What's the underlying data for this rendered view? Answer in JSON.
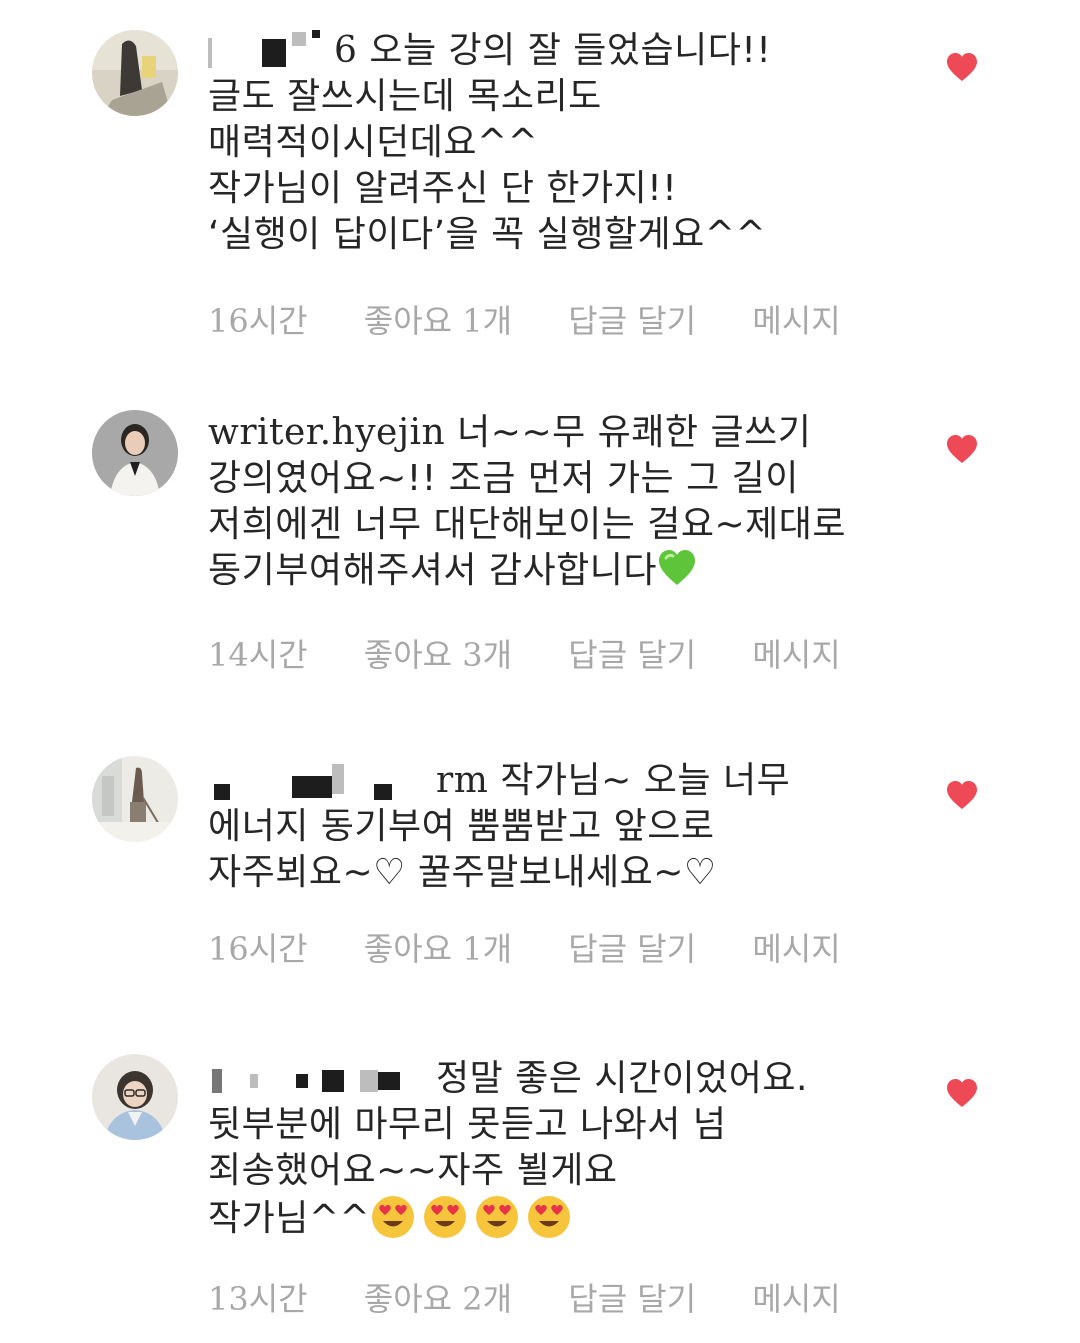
{
  "colors": {
    "like_heart": "#ed4956",
    "meta_text": "#a8a8a8",
    "body_text": "#262626",
    "green_heart": "#5ec43a",
    "face_emoji": "#f7c53b"
  },
  "comments": [
    {
      "username": "",
      "username_suffix": "6",
      "lines": [
        "오늘 강의 잘 들었습니다!!",
        "글도 잘쓰시는데 목소리도",
        "매력적이시던데요^^",
        "작가님이 알려주신 단 한가지!!",
        "‘실행이 답이다’을 꼭 실행할게요^^"
      ],
      "time": "16시간",
      "likes": "좋아요 1개",
      "reply": "답글 달기",
      "message": "메시지",
      "liked": true
    },
    {
      "username": "writer.hyejin",
      "lines": [
        "너~~무 유쾌한 글쓰기",
        "강의였어요~!! 조금 먼저 가는 그 길이",
        "저희에겐 너무 대단해보이는 걸요~제대로",
        "동기부여해주셔서 감사합니다"
      ],
      "trailing_emoji": "green-heart",
      "time": "14시간",
      "likes": "좋아요 3개",
      "reply": "답글 달기",
      "message": "메시지",
      "liked": true
    },
    {
      "username": "",
      "username_suffix": "rm",
      "lines": [
        "작가님~  오늘 너무",
        "에너지 동기부여 뿜뿜받고 앞으로",
        "자주뵈요~♡ 꿀주말보내세요~♡"
      ],
      "time": "16시간",
      "likes": "좋아요 1개",
      "reply": "답글 달기",
      "message": "메시지",
      "liked": true
    },
    {
      "username": "",
      "lines": [
        "정말 좋은 시간이었어요.",
        "뒷부분에 마무리 못듣고 나와서 넘",
        "죄송했어요~~자주 뵐게요",
        "작가님^^"
      ],
      "trailing_emoji": "heart-eyes-x4",
      "time": "13시간",
      "likes": "좋아요 2개",
      "reply": "답글 달기",
      "message": "메시지",
      "liked": true
    }
  ]
}
